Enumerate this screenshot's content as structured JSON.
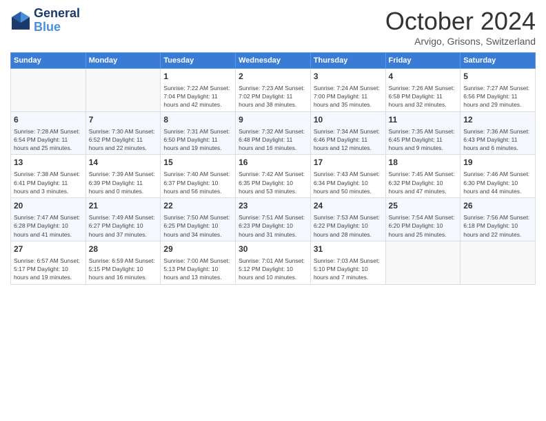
{
  "header": {
    "logo_line1": "General",
    "logo_line2": "Blue",
    "month_title": "October 2024",
    "location": "Arvigo, Grisons, Switzerland"
  },
  "weekdays": [
    "Sunday",
    "Monday",
    "Tuesday",
    "Wednesday",
    "Thursday",
    "Friday",
    "Saturday"
  ],
  "weeks": [
    [
      {
        "day": "",
        "detail": ""
      },
      {
        "day": "",
        "detail": ""
      },
      {
        "day": "1",
        "detail": "Sunrise: 7:22 AM\nSunset: 7:04 PM\nDaylight: 11 hours\nand 42 minutes."
      },
      {
        "day": "2",
        "detail": "Sunrise: 7:23 AM\nSunset: 7:02 PM\nDaylight: 11 hours\nand 38 minutes."
      },
      {
        "day": "3",
        "detail": "Sunrise: 7:24 AM\nSunset: 7:00 PM\nDaylight: 11 hours\nand 35 minutes."
      },
      {
        "day": "4",
        "detail": "Sunrise: 7:26 AM\nSunset: 6:58 PM\nDaylight: 11 hours\nand 32 minutes."
      },
      {
        "day": "5",
        "detail": "Sunrise: 7:27 AM\nSunset: 6:56 PM\nDaylight: 11 hours\nand 29 minutes."
      }
    ],
    [
      {
        "day": "6",
        "detail": "Sunrise: 7:28 AM\nSunset: 6:54 PM\nDaylight: 11 hours\nand 25 minutes."
      },
      {
        "day": "7",
        "detail": "Sunrise: 7:30 AM\nSunset: 6:52 PM\nDaylight: 11 hours\nand 22 minutes."
      },
      {
        "day": "8",
        "detail": "Sunrise: 7:31 AM\nSunset: 6:50 PM\nDaylight: 11 hours\nand 19 minutes."
      },
      {
        "day": "9",
        "detail": "Sunrise: 7:32 AM\nSunset: 6:48 PM\nDaylight: 11 hours\nand 16 minutes."
      },
      {
        "day": "10",
        "detail": "Sunrise: 7:34 AM\nSunset: 6:46 PM\nDaylight: 11 hours\nand 12 minutes."
      },
      {
        "day": "11",
        "detail": "Sunrise: 7:35 AM\nSunset: 6:45 PM\nDaylight: 11 hours\nand 9 minutes."
      },
      {
        "day": "12",
        "detail": "Sunrise: 7:36 AM\nSunset: 6:43 PM\nDaylight: 11 hours\nand 6 minutes."
      }
    ],
    [
      {
        "day": "13",
        "detail": "Sunrise: 7:38 AM\nSunset: 6:41 PM\nDaylight: 11 hours\nand 3 minutes."
      },
      {
        "day": "14",
        "detail": "Sunrise: 7:39 AM\nSunset: 6:39 PM\nDaylight: 11 hours\nand 0 minutes."
      },
      {
        "day": "15",
        "detail": "Sunrise: 7:40 AM\nSunset: 6:37 PM\nDaylight: 10 hours\nand 56 minutes."
      },
      {
        "day": "16",
        "detail": "Sunrise: 7:42 AM\nSunset: 6:35 PM\nDaylight: 10 hours\nand 53 minutes."
      },
      {
        "day": "17",
        "detail": "Sunrise: 7:43 AM\nSunset: 6:34 PM\nDaylight: 10 hours\nand 50 minutes."
      },
      {
        "day": "18",
        "detail": "Sunrise: 7:45 AM\nSunset: 6:32 PM\nDaylight: 10 hours\nand 47 minutes."
      },
      {
        "day": "19",
        "detail": "Sunrise: 7:46 AM\nSunset: 6:30 PM\nDaylight: 10 hours\nand 44 minutes."
      }
    ],
    [
      {
        "day": "20",
        "detail": "Sunrise: 7:47 AM\nSunset: 6:28 PM\nDaylight: 10 hours\nand 41 minutes."
      },
      {
        "day": "21",
        "detail": "Sunrise: 7:49 AM\nSunset: 6:27 PM\nDaylight: 10 hours\nand 37 minutes."
      },
      {
        "day": "22",
        "detail": "Sunrise: 7:50 AM\nSunset: 6:25 PM\nDaylight: 10 hours\nand 34 minutes."
      },
      {
        "day": "23",
        "detail": "Sunrise: 7:51 AM\nSunset: 6:23 PM\nDaylight: 10 hours\nand 31 minutes."
      },
      {
        "day": "24",
        "detail": "Sunrise: 7:53 AM\nSunset: 6:22 PM\nDaylight: 10 hours\nand 28 minutes."
      },
      {
        "day": "25",
        "detail": "Sunrise: 7:54 AM\nSunset: 6:20 PM\nDaylight: 10 hours\nand 25 minutes."
      },
      {
        "day": "26",
        "detail": "Sunrise: 7:56 AM\nSunset: 6:18 PM\nDaylight: 10 hours\nand 22 minutes."
      }
    ],
    [
      {
        "day": "27",
        "detail": "Sunrise: 6:57 AM\nSunset: 5:17 PM\nDaylight: 10 hours\nand 19 minutes."
      },
      {
        "day": "28",
        "detail": "Sunrise: 6:59 AM\nSunset: 5:15 PM\nDaylight: 10 hours\nand 16 minutes."
      },
      {
        "day": "29",
        "detail": "Sunrise: 7:00 AM\nSunset: 5:13 PM\nDaylight: 10 hours\nand 13 minutes."
      },
      {
        "day": "30",
        "detail": "Sunrise: 7:01 AM\nSunset: 5:12 PM\nDaylight: 10 hours\nand 10 minutes."
      },
      {
        "day": "31",
        "detail": "Sunrise: 7:03 AM\nSunset: 5:10 PM\nDaylight: 10 hours\nand 7 minutes."
      },
      {
        "day": "",
        "detail": ""
      },
      {
        "day": "",
        "detail": ""
      }
    ]
  ]
}
